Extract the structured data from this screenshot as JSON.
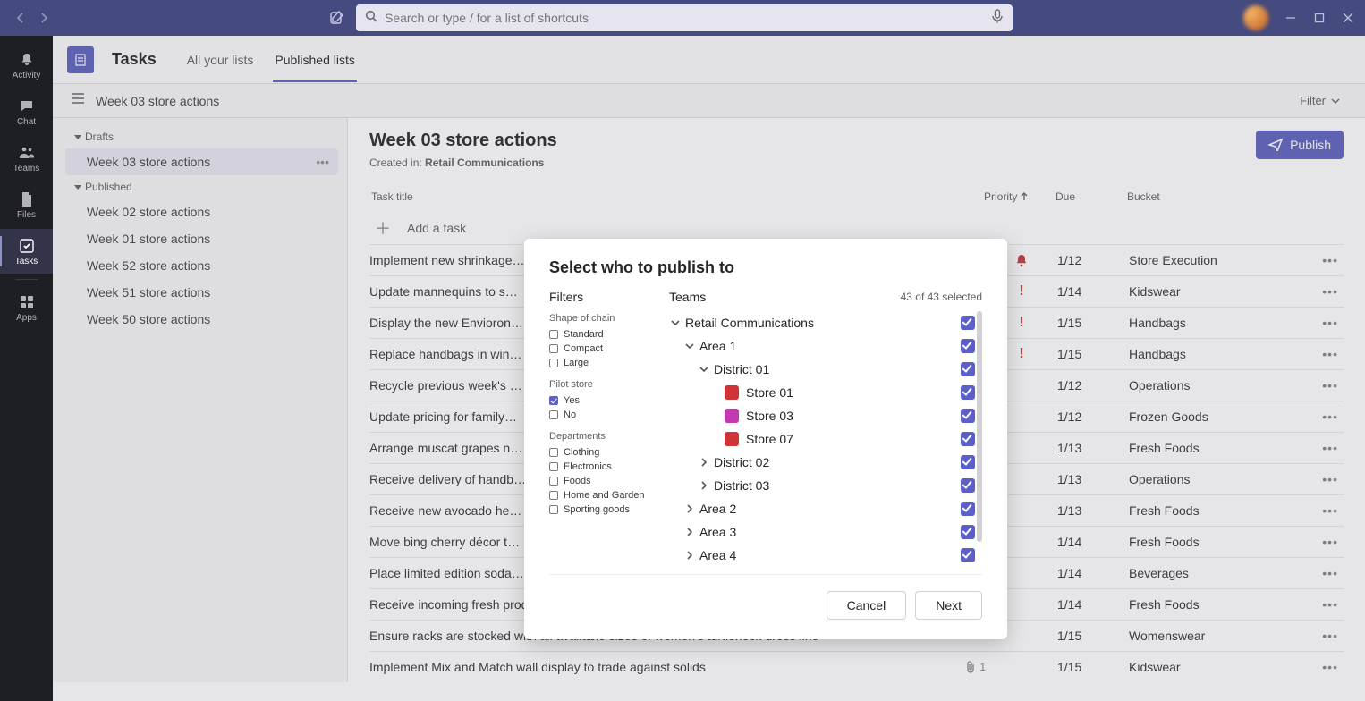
{
  "search": {
    "placeholder": "Search or type / for a list of shortcuts"
  },
  "rail": {
    "items": [
      {
        "key": "activity",
        "label": "Activity"
      },
      {
        "key": "chat",
        "label": "Chat"
      },
      {
        "key": "teams",
        "label": "Teams"
      },
      {
        "key": "files",
        "label": "Files"
      },
      {
        "key": "tasks",
        "label": "Tasks"
      },
      {
        "key": "apps",
        "label": "Apps"
      }
    ]
  },
  "app": {
    "title": "Tasks",
    "tabs": [
      {
        "key": "all",
        "label": "All your lists",
        "active": false
      },
      {
        "key": "pub",
        "label": "Published lists",
        "active": true
      }
    ]
  },
  "subhead": {
    "title": "Week 03 store actions",
    "filter": "Filter"
  },
  "sidebar": {
    "groups": [
      {
        "label": "Drafts",
        "items": [
          {
            "label": "Week 03 store actions",
            "selected": true
          }
        ]
      },
      {
        "label": "Published",
        "items": [
          {
            "label": "Week 02 store actions"
          },
          {
            "label": "Week 01 store actions"
          },
          {
            "label": "Week 52 store actions"
          },
          {
            "label": "Week 51 store actions"
          },
          {
            "label": "Week 50 store actions"
          }
        ]
      }
    ]
  },
  "content": {
    "title": "Week 03 store actions",
    "created_in_label": "Created in:",
    "created_in_value": "Retail Communications",
    "publish_btn": "Publish",
    "add_task": "Add a task",
    "columns": {
      "title": "Task title",
      "priority": "Priority",
      "due": "Due",
      "bucket": "Bucket"
    },
    "tasks": [
      {
        "title": "Implement new shrinkage…",
        "priority": "urgent",
        "due": "1/12",
        "bucket": "Store Execution"
      },
      {
        "title": "Update mannequins to s…",
        "priority": "important",
        "due": "1/14",
        "bucket": "Kidswear"
      },
      {
        "title": "Display the new Envioron…",
        "priority": "important",
        "due": "1/15",
        "bucket": "Handbags"
      },
      {
        "title": "Replace handbags in win…",
        "priority": "important",
        "due": "1/15",
        "bucket": "Handbags"
      },
      {
        "title": "Recycle previous week's …",
        "priority": "",
        "due": "1/12",
        "bucket": "Operations"
      },
      {
        "title": "Update pricing for family…",
        "priority": "",
        "due": "1/12",
        "bucket": "Frozen Goods"
      },
      {
        "title": "Arrange muscat grapes n…",
        "priority": "",
        "due": "1/13",
        "bucket": "Fresh Foods"
      },
      {
        "title": "Receive delivery of handb…",
        "priority": "",
        "due": "1/13",
        "bucket": "Operations"
      },
      {
        "title": "Receive new avocado he…",
        "priority": "",
        "due": "1/13",
        "bucket": "Fresh Foods"
      },
      {
        "title": "Move bing cherry décor t…",
        "priority": "",
        "due": "1/14",
        "bucket": "Fresh Foods"
      },
      {
        "title": "Place limited edition soda…",
        "priority": "",
        "due": "1/14",
        "bucket": "Beverages"
      },
      {
        "title": "Receive incoming fresh produce delivery",
        "priority": "",
        "due": "1/14",
        "bucket": "Fresh Foods"
      },
      {
        "title": "Ensure racks are stocked with all available sizes of women's turtleneck dress line",
        "priority": "",
        "due": "1/15",
        "bucket": "Womenswear"
      },
      {
        "title": "Implement Mix and Match wall display to trade against solids",
        "priority": "",
        "due": "1/15",
        "bucket": "Kidswear",
        "attachments": "1"
      }
    ]
  },
  "modal": {
    "title": "Select who to publish to",
    "filters_label": "Filters",
    "teams_label": "Teams",
    "selected_text": "43 of 43 selected",
    "cancel": "Cancel",
    "next": "Next",
    "filter_groups": [
      {
        "label": "Shape of chain",
        "options": [
          {
            "label": "Standard"
          },
          {
            "label": "Compact"
          },
          {
            "label": "Large"
          }
        ]
      },
      {
        "label": "Pilot store",
        "options": [
          {
            "label": "Yes",
            "checked": true
          },
          {
            "label": "No"
          }
        ]
      },
      {
        "label": "Departments",
        "options": [
          {
            "label": "Clothing"
          },
          {
            "label": "Electronics"
          },
          {
            "label": "Foods"
          },
          {
            "label": "Home and Garden"
          },
          {
            "label": "Sporting goods"
          }
        ]
      }
    ],
    "tree": [
      {
        "indent": 0,
        "caret": "down",
        "label": "Retail Communications"
      },
      {
        "indent": 1,
        "caret": "down",
        "label": "Area 1"
      },
      {
        "indent": 2,
        "caret": "down",
        "label": "District 01"
      },
      {
        "indent": 3,
        "caret": "none",
        "label": "Store 01",
        "icon": "red"
      },
      {
        "indent": 3,
        "caret": "none",
        "label": "Store 03",
        "icon": "pink"
      },
      {
        "indent": 3,
        "caret": "none",
        "label": "Store 07",
        "icon": "red"
      },
      {
        "indent": 2,
        "caret": "right",
        "label": "District 02"
      },
      {
        "indent": 2,
        "caret": "right",
        "label": "District 03"
      },
      {
        "indent": 1,
        "caret": "right",
        "label": "Area 2"
      },
      {
        "indent": 1,
        "caret": "right",
        "label": "Area 3"
      },
      {
        "indent": 1,
        "caret": "right",
        "label": "Area 4"
      }
    ]
  }
}
